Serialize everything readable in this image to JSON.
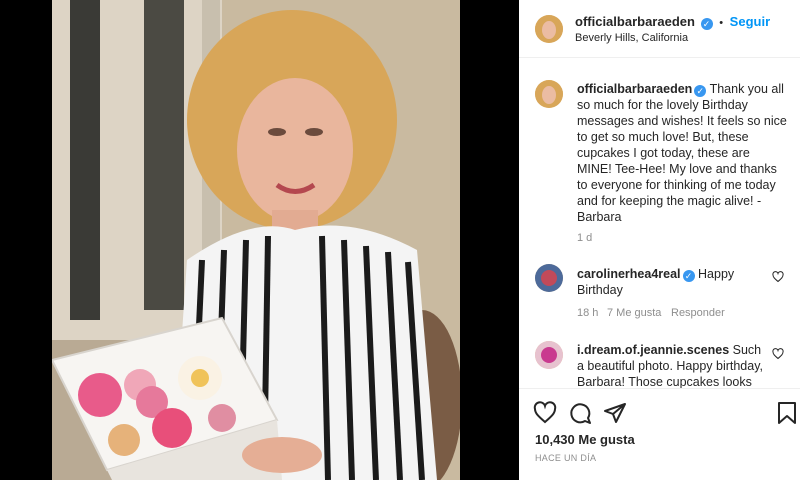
{
  "post": {
    "username": "officialbarbaraeden",
    "dot": "•",
    "follow_label": "Seguir",
    "location": "Beverly Hills, California"
  },
  "caption": {
    "username": "officialbarbaraeden",
    "text": "Thank you all so much for the lovely Birthday messages and wishes! It feels so nice to get so much love! But, these cupcakes I got today, these are MINE! Tee-Hee! My love and thanks to everyone for thinking of me today and for keeping the magic alive! -Barbara",
    "time": "1 d"
  },
  "comments": [
    {
      "username": "carolinerhea4real",
      "text": "Happy Birthday",
      "time": "18 h",
      "likes": "7 Me gusta",
      "reply": "Responder"
    },
    {
      "username": "i.dream.of.jeannie.scenes",
      "text": "Such a beautiful photo. Happy birthday, Barbara! Those cupcakes looks"
    }
  ],
  "stats": {
    "likes": "10,430 Me gusta",
    "date": "HACE UN DÍA"
  },
  "icons": [
    "heart-icon",
    "comment-icon",
    "share-icon",
    "bookmark-icon",
    "verified-icon"
  ],
  "colors": {
    "link_blue": "#0095f6",
    "verified": "#3897f0",
    "text": "#262626",
    "muted": "#8e8e8e"
  }
}
